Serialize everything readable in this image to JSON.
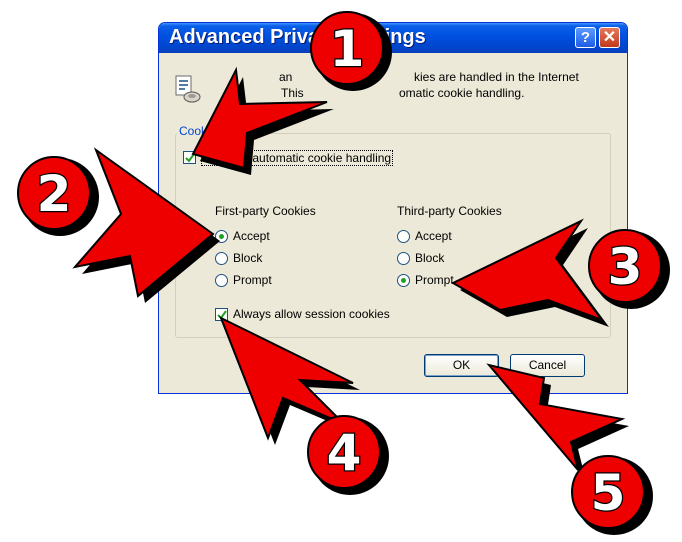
{
  "dialog": {
    "title": "Advanced Privacy Settings",
    "help_glyph": "?",
    "close_glyph": "✕",
    "intro_left_line1": "an",
    "intro_mid_line1": "kies are handled in the Internet",
    "intro_line2": "This",
    "intro_mid_line2": "omatic cookie handling.",
    "group_label": "Cook",
    "override_label": "Override automatic cookie handling",
    "override_checked": true,
    "first_party": {
      "header": "First-party Cookies",
      "options": [
        "Accept",
        "Block",
        "Prompt"
      ],
      "selected": "Accept"
    },
    "third_party": {
      "header": "Third-party Cookies",
      "options": [
        "Accept",
        "Block",
        "Prompt"
      ],
      "selected": "Prompt"
    },
    "session_label": "Always allow session cookies",
    "session_checked": true,
    "ok_label": "OK",
    "cancel_label": "Cancel"
  },
  "callouts": [
    "1",
    "2",
    "3",
    "4",
    "5"
  ],
  "colors": {
    "title_bar": "#0050e0",
    "dialog_face": "#ece9d8",
    "callout_red": "#ee0000",
    "check_green": "#21a121"
  }
}
